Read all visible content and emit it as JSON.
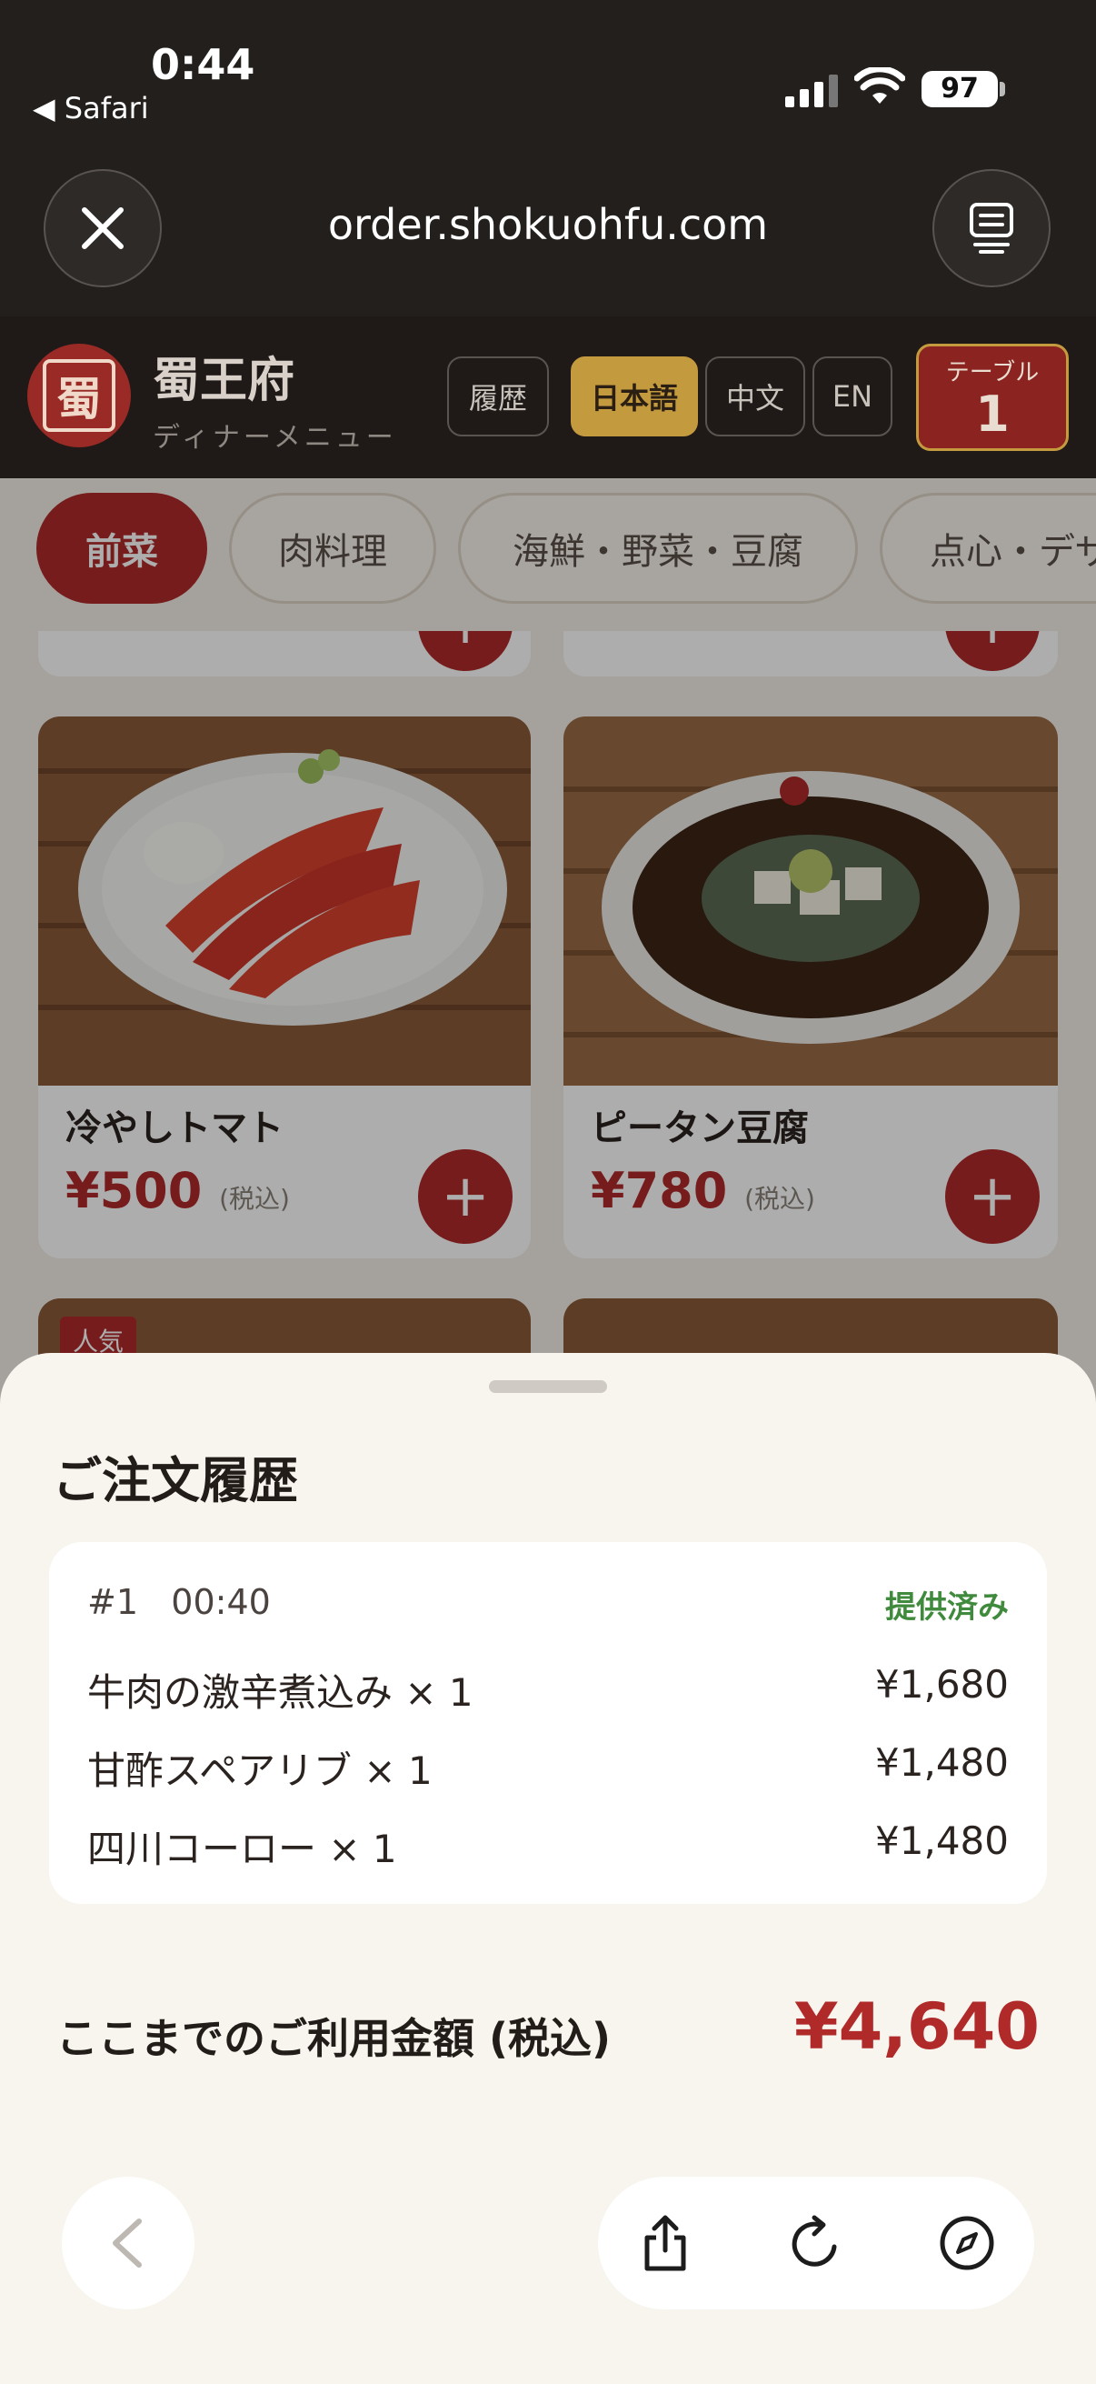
{
  "status_bar": {
    "time": "0:44",
    "back_app": "◀ Safari",
    "battery": "97"
  },
  "browser": {
    "url": "order.shokuohfu.com"
  },
  "header": {
    "logo_glyph": "蜀",
    "brand": "蜀王府",
    "subtitle": "ディナーメニュー",
    "history": "履歴",
    "languages": [
      "日本語",
      "中文",
      "EN"
    ],
    "table_label": "テーブル",
    "table_number": "1"
  },
  "categories": [
    "前菜",
    "肉料理",
    "海鮮・野菜・豆腐",
    "点心・デザ"
  ],
  "menu": {
    "tax_label": "(税込)",
    "popular_badge": "人気",
    "items": [
      {
        "name": "冷やしトマト",
        "price": "¥500"
      },
      {
        "name": "ピータン豆腐",
        "price": "¥780"
      }
    ]
  },
  "sheet": {
    "title": "ご注文履歴",
    "order_number": "#1",
    "order_time": "00:40",
    "order_status": "提供済み",
    "lines": [
      {
        "item": "牛肉の激辛煮込み × 1",
        "amount": "¥1,680"
      },
      {
        "item": "甘酢スペアリブ × 1",
        "amount": "¥1,480"
      },
      {
        "item": "四川コーロー × 1",
        "amount": "¥1,480"
      }
    ],
    "total_label": "ここまでのご利用金額 (税込)",
    "total_amount": "¥4,640"
  },
  "colors": {
    "accent": "#b02a2a",
    "gold": "#c49a3f",
    "served": "#3f8a3c",
    "dark": "#231f1d"
  }
}
